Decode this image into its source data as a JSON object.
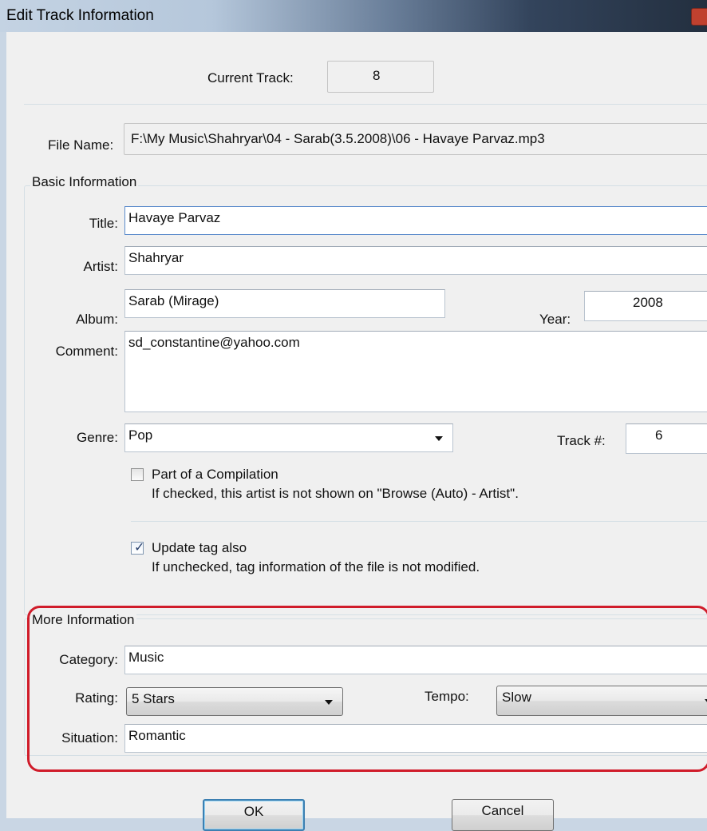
{
  "window": {
    "title": "Edit Track Information"
  },
  "current_track": {
    "label": "Current Track:",
    "value": "8"
  },
  "file_name": {
    "label": "File Name:",
    "value": "F:\\My Music\\Shahryar\\04 - Sarab(3.5.2008)\\06 - Havaye Parvaz.mp3"
  },
  "basic": {
    "legend": "Basic Information",
    "title_label": "Title:",
    "title_value": "Havaye Parvaz",
    "artist_label": "Artist:",
    "artist_value": "Shahryar",
    "album_label": "Album:",
    "album_value": "Sarab (Mirage)",
    "year_label": "Year:",
    "year_value": "2008",
    "comment_label": "Comment:",
    "comment_value": "sd_constantine@yahoo.com",
    "genre_label": "Genre:",
    "genre_value": "Pop",
    "track_label": "Track #:",
    "track_value": "6",
    "compilation_label": "Part of a Compilation",
    "compilation_checked": false,
    "compilation_hint": "If checked, this artist is not shown on \"Browse (Auto) - Artist\".",
    "update_tag_label": "Update tag also",
    "update_tag_checked": true,
    "update_tag_hint": "If unchecked, tag information of the file is not modified."
  },
  "more": {
    "legend": "More Information",
    "category_label": "Category:",
    "category_value": "Music",
    "rating_label": "Rating:",
    "rating_value": "5 Stars",
    "tempo_label": "Tempo:",
    "tempo_value": "Slow",
    "situation_label": "Situation:",
    "situation_value": "Romantic"
  },
  "buttons": {
    "ok": "OK",
    "cancel": "Cancel"
  },
  "colors": {
    "highlight_frame": "#d01c2a",
    "focus_border": "#5d8ccc"
  },
  "icons": {
    "check": "checkmark-icon",
    "dropdown": "chevron-down-icon"
  }
}
